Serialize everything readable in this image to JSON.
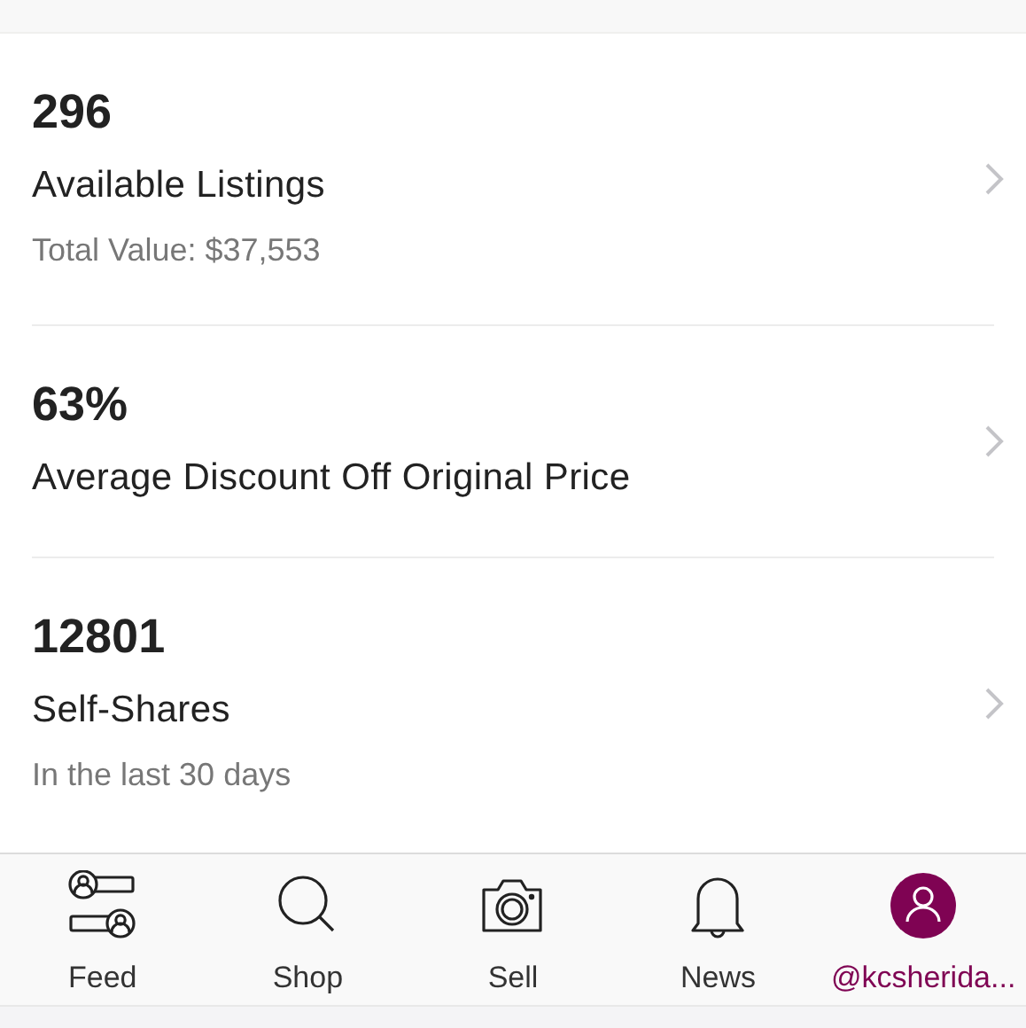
{
  "stats": [
    {
      "value": "296",
      "title": "Available Listings",
      "subtitle": "Total Value: $37,553"
    },
    {
      "value": "63%",
      "title": "Average Discount Off Original Price"
    },
    {
      "value": "12801",
      "title": "Self-Shares",
      "subtitle": "In the last 30 days"
    }
  ],
  "tab_bar": [
    {
      "kind": "feed",
      "label": "Feed",
      "selected": false
    },
    {
      "kind": "shop",
      "label": "Shop",
      "selected": false
    },
    {
      "kind": "sell",
      "label": "Sell",
      "selected": false
    },
    {
      "kind": "news",
      "label": "News",
      "selected": false
    },
    {
      "kind": "profile",
      "label": "@kcsherida...",
      "selected": true
    }
  ]
}
